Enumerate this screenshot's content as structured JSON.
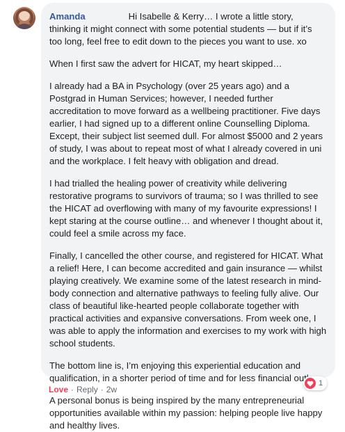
{
  "comment": {
    "author": "Amanda",
    "paragraphs": [
      "Hi Isabelle & Kerry… I wrote a little story, thinking it might connect with some potential students — but if it’s too long, feel free to edit down to the pieces you want to use. xo",
      "When I first saw the advert for HICAT, my heart skipped…",
      "I already had a BA in Psychology (over 25 years ago) and a Postgrad in Human Services; however, I needed further accreditation to move forward as a wellbeing practitioner. Five days earlier, I had signed up to a different online Counselling Diploma. Except, their subject list seemed dull. For almost $5000 and 2 years of study, I was about to repeat most of what I already covered in uni and the workplace. I felt heavy with obligation and dread.",
      "I had trialled the healing power of creativity while delivering restorative programs to survivors of trauma; so I was thrilled to see the HICAT ad overflowing with many of my favourite expressions! I kept staring at the course outline… and whenever I thought about it, could feel a smile across my face.",
      "Finally, I cancelled the other course, and registered for HICAT. What a relief! Here, I can become accredited and gain insurance — whilst playing creatively. We examine some of the latest research in mind-body connection and alternative pathways to feeling fully alive. Our class of beautiful like-hearted people collaborate together with practical activities and expansive conversations. From week one, I was able to apply the information and exercises to my work with high school students.",
      "The bottom line is, I’m enjoying this experiential education and qualification, in a shorter period of time and for less financial outlay.",
      "A personal bonus is being inspired by the many entrepreneurial opportunities available within my passion: helping people live happy and healthy lives."
    ]
  },
  "actions": {
    "love": "Love",
    "separator": "·",
    "reply": "Reply",
    "time": "2w"
  },
  "reactions": {
    "icon": "heart-icon",
    "count": "1",
    "color": "#f33e58"
  }
}
